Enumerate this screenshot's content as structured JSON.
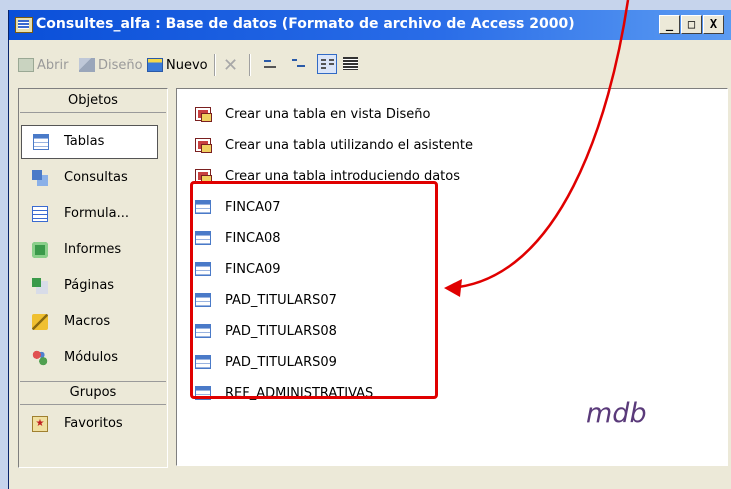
{
  "window": {
    "title": "Consultes_alfa : Base de datos (Formato de archivo de Access 2000)",
    "controls": {
      "minimize": "_",
      "maximize": "□",
      "close": "X"
    }
  },
  "toolbar": {
    "open_label": "Abrir",
    "design_label": "Diseño",
    "new_label": "Nuevo",
    "delete_icon": "delete-x-icon",
    "view_icons": [
      "large-icons-view-icon",
      "small-icons-view-icon",
      "list-view-icon",
      "details-view-icon"
    ],
    "active_view": "list"
  },
  "sidebar": {
    "objects_header": "Objetos",
    "items": [
      {
        "label": "Tablas",
        "icon": "table-icon",
        "selected": true
      },
      {
        "label": "Consultas",
        "icon": "query-icon"
      },
      {
        "label": "Formula...",
        "icon": "form-icon"
      },
      {
        "label": "Informes",
        "icon": "report-icon"
      },
      {
        "label": "Páginas",
        "icon": "page-icon"
      },
      {
        "label": "Macros",
        "icon": "macro-icon"
      },
      {
        "label": "Módulos",
        "icon": "module-icon"
      }
    ],
    "groups_header": "Grupos",
    "groups": [
      {
        "label": "Favoritos",
        "icon": "favorites-icon"
      }
    ]
  },
  "content": {
    "shortcuts": [
      {
        "label": "Crear una tabla en vista Diseño",
        "icon": "create-design-icon"
      },
      {
        "label": "Crear una tabla utilizando el asistente",
        "icon": "create-wizard-icon"
      },
      {
        "label": "Crear una tabla introduciendo datos",
        "icon": "create-data-entry-icon"
      }
    ],
    "tables": [
      {
        "label": "FINCA07"
      },
      {
        "label": "FINCA08"
      },
      {
        "label": "FINCA09"
      },
      {
        "label": "PAD_TITULARS07"
      },
      {
        "label": "PAD_TITULARS08"
      },
      {
        "label": "PAD_TITULARS09"
      },
      {
        "label": "REF_ADMINISTRATIVAS"
      }
    ]
  },
  "annotation": {
    "text": "mdb",
    "highlight_color": "#e00000",
    "text_color": "#5a3a7a"
  }
}
